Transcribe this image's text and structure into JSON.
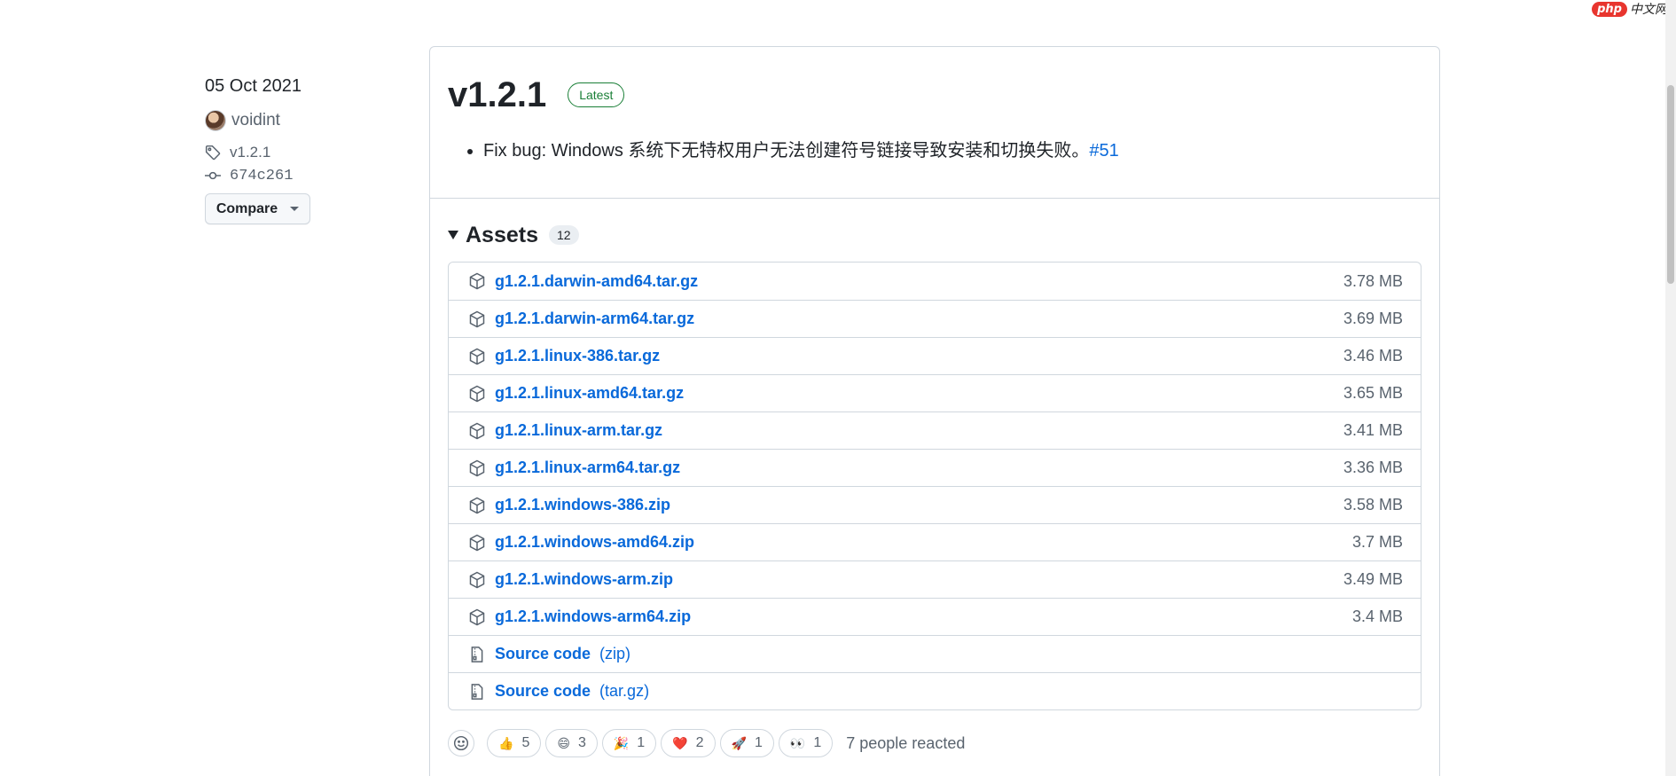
{
  "watermark": {
    "logo": "php",
    "text": "中文网"
  },
  "meta": {
    "date": "05 Oct 2021",
    "author": "voidint",
    "tag": "v1.2.1",
    "commit": "674c261",
    "compare_label": "Compare"
  },
  "release": {
    "title": "v1.2.1",
    "badge": "Latest",
    "note_text": "Fix bug: Windows 系统下无特权用户无法创建符号链接导致安装和切换失败。",
    "note_link": "#51"
  },
  "assets": {
    "title": "Assets",
    "count": "12",
    "items": [
      {
        "name": "g1.2.1.darwin-amd64.tar.gz",
        "size": "3.78 MB"
      },
      {
        "name": "g1.2.1.darwin-arm64.tar.gz",
        "size": "3.69 MB"
      },
      {
        "name": "g1.2.1.linux-386.tar.gz",
        "size": "3.46 MB"
      },
      {
        "name": "g1.2.1.linux-amd64.tar.gz",
        "size": "3.65 MB"
      },
      {
        "name": "g1.2.1.linux-arm.tar.gz",
        "size": "3.41 MB"
      },
      {
        "name": "g1.2.1.linux-arm64.tar.gz",
        "size": "3.36 MB"
      },
      {
        "name": "g1.2.1.windows-386.zip",
        "size": "3.58 MB"
      },
      {
        "name": "g1.2.1.windows-amd64.zip",
        "size": "3.7 MB"
      },
      {
        "name": "g1.2.1.windows-arm.zip",
        "size": "3.49 MB"
      },
      {
        "name": "g1.2.1.windows-arm64.zip",
        "size": "3.4 MB"
      }
    ],
    "sources": [
      {
        "name": "Source code",
        "suffix": "(zip)"
      },
      {
        "name": "Source code",
        "suffix": "(tar.gz)"
      }
    ]
  },
  "reactions": {
    "items": [
      {
        "emoji": "👍",
        "count": "5",
        "name": "thumbs-up"
      },
      {
        "emoji": "😄",
        "count": "3",
        "name": "laugh"
      },
      {
        "emoji": "🎉",
        "count": "1",
        "name": "hooray"
      },
      {
        "emoji": "❤️",
        "count": "2",
        "name": "heart"
      },
      {
        "emoji": "🚀",
        "count": "1",
        "name": "rocket"
      },
      {
        "emoji": "👀",
        "count": "1",
        "name": "eyes"
      }
    ],
    "summary": "7 people reacted"
  }
}
